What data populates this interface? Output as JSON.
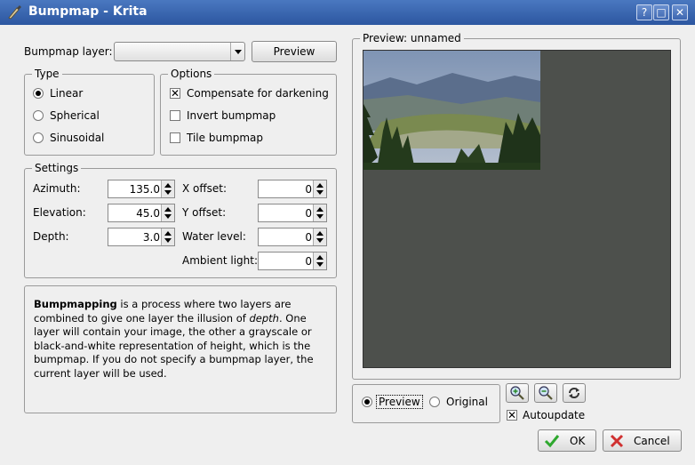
{
  "window": {
    "title": "Bumpmap - Krita",
    "help": "?",
    "maximize": "□",
    "close": "✕"
  },
  "bumpmap_layer": {
    "label": "Bumpmap layer:",
    "value": "",
    "preview_button": "Preview"
  },
  "type": {
    "title": "Type",
    "options": [
      "Linear",
      "Spherical",
      "Sinusoidal"
    ],
    "selected": "Linear"
  },
  "options": {
    "title": "Options",
    "items": [
      {
        "label": "Compensate for darkening",
        "checked": true
      },
      {
        "label": "Invert bumpmap",
        "checked": false
      },
      {
        "label": "Tile bumpmap",
        "checked": false
      }
    ]
  },
  "settings": {
    "title": "Settings",
    "azimuth": {
      "label": "Azimuth:",
      "value": "135.0"
    },
    "elevation": {
      "label": "Elevation:",
      "value": "45.0"
    },
    "depth": {
      "label": "Depth:",
      "value": "3.0"
    },
    "x_offset": {
      "label": "X offset:",
      "value": "0"
    },
    "y_offset": {
      "label": "Y offset:",
      "value": "0"
    },
    "water_level": {
      "label": "Water level:",
      "value": "0"
    },
    "ambient_light": {
      "label": "Ambient light:",
      "value": "0"
    }
  },
  "description": {
    "bold": "Bumpmapping",
    "part1": " is a process where two layers are combined to give one layer the illusion of ",
    "italic": "depth",
    "part2": ". One layer will contain your image, the other a grayscale or black-and-white representation of height, which is the bumpmap. If you do not specify a bumpmap layer, the current layer will be used."
  },
  "preview": {
    "title": "Preview: unnamed",
    "mode_preview": "Preview",
    "mode_original": "Original",
    "selected_mode": "Preview",
    "autoupdate": "Autoupdate",
    "autoupdate_checked": true
  },
  "buttons": {
    "ok": "OK",
    "cancel": "Cancel"
  },
  "colors": {
    "titlebar": "#2c56a0",
    "preview_bg": "#4d504c",
    "ok_icon": "#2ea82e",
    "cancel_icon": "#d03030"
  }
}
